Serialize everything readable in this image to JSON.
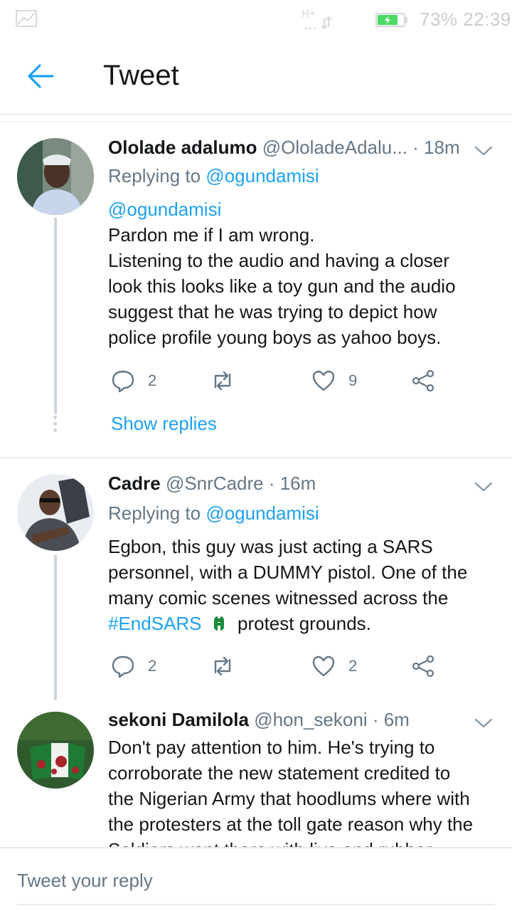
{
  "status_bar": {
    "network": "H+",
    "battery": "73%",
    "time": "22:39",
    "icons": [
      "chart-icon",
      "network-icon",
      "battery-icon"
    ]
  },
  "header": {
    "title": "Tweet",
    "back_icon": "arrow-left-icon"
  },
  "tweets": [
    {
      "name": "Ololade adalumo",
      "handle": "@OloladeAdalu...",
      "time": "· 18m",
      "replying_prefix": "Replying to",
      "replying_to": "@ogundamisi",
      "mention": "@ogundamisi",
      "lines": [
        "Pardon me if I am wrong.",
        "Listening to the audio and having a closer",
        "look this looks like a toy gun and the audio",
        "suggest that he was trying to depict how",
        "police profile young boys as yahoo boys."
      ],
      "reply_count": "2",
      "retweet_count": "",
      "like_count": "9",
      "show_replies": "Show replies"
    },
    {
      "name": "Cadre",
      "handle": "@SnrCadre",
      "time": "· 16m",
      "replying_prefix": "Replying to",
      "replying_to": "@ogundamisi",
      "lines": [
        "Egbon, this guy was just acting a SARS",
        "personnel, with a DUMMY pistol. One of the",
        "many comic scenes witnessed across the"
      ],
      "hashtag": "#EndSARS",
      "last_line_rest": "protest grounds.",
      "reply_count": "2",
      "retweet_count": "",
      "like_count": "2"
    },
    {
      "name": "sekoni Damilola",
      "handle": "@hon_sekoni",
      "time": "· 6m",
      "lines": [
        "Don't pay attention to him. He's trying to",
        "corroborate the new statement credited to",
        "the Nigerian Army that hoodlums where with",
        "the protesters at the toll gate reason why the",
        "Soldiers went there with live and rubber"
      ]
    }
  ],
  "reply_bar": {
    "placeholder": "Tweet your reply"
  },
  "colors": {
    "accent": "#1da1f2",
    "secondary_text": "#657786",
    "divider": "#e6ecf0"
  }
}
